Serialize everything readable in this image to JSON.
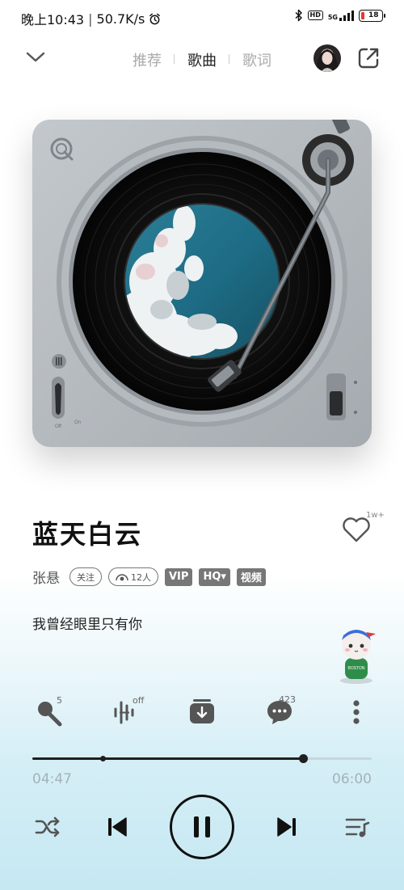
{
  "status": {
    "time": "晚上10:43",
    "net_speed": "50.7K/s",
    "battery": "18",
    "battery_level": 0.18,
    "hd": "HD",
    "network": "5G"
  },
  "header": {
    "tabs": [
      {
        "label": "推荐"
      },
      {
        "label": "歌曲"
      },
      {
        "label": "歌词"
      }
    ],
    "active_tab": 1
  },
  "song": {
    "title": "蓝天白云",
    "artist": "张悬",
    "follow_label": "关注",
    "listeners": "12人",
    "tags": [
      "VIP",
      "HQ▾",
      "视频"
    ],
    "lyric": "我曾经眼里只有你",
    "like_count": "1w+"
  },
  "actions": {
    "sing_badge": "5",
    "effect_badge": "off",
    "comment_badge": "423"
  },
  "player": {
    "current_time": "04:47",
    "total_time": "06:00",
    "progress": 0.7972,
    "buffered": 0.2083
  },
  "icons": {
    "collapse": "chevron-down-icon",
    "share": "share-icon",
    "like": "heart-icon",
    "sing": "microphone-icon",
    "effect": "sound-effect-icon",
    "download": "download-icon",
    "comment": "comment-icon",
    "more": "more-icon",
    "shuffle": "shuffle-icon",
    "prev": "previous-icon",
    "pause": "pause-icon",
    "next": "next-icon",
    "playlist": "playlist-icon"
  },
  "colors": {
    "accent": "#1f1f1f",
    "turntable": "#b6bbc0",
    "battery_low": "#e53935",
    "time_text": "#a4b2b8"
  }
}
